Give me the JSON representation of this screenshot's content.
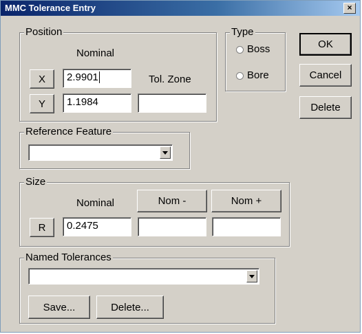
{
  "window": {
    "title": "MMC Tolerance Entry",
    "close_glyph": "×"
  },
  "position": {
    "legend": "Position",
    "nominal_label": "Nominal",
    "tol_zone_label": "Tol. Zone",
    "x_button": "X",
    "y_button": "Y",
    "x_value": "2.9901",
    "y_value": "1.1984",
    "tol_zone_value": ""
  },
  "type": {
    "legend": "Type",
    "boss_label": "Boss",
    "bore_label": "Bore"
  },
  "buttons": {
    "ok": "OK",
    "cancel": "Cancel",
    "delete": "Delete"
  },
  "reference": {
    "legend": "Reference Feature",
    "selected": ""
  },
  "size": {
    "legend": "Size",
    "nominal_label": "Nominal",
    "nom_minus": "Nom -",
    "nom_plus": "Nom +",
    "r_button": "R",
    "r_value": "0.2475",
    "nom_minus_value": "",
    "nom_plus_value": ""
  },
  "named": {
    "legend": "Named Tolerances",
    "selected": "",
    "save": "Save...",
    "delete": "Delete..."
  },
  "icons": {
    "dropdown": "chevron-down-icon",
    "radio": "radio-icon"
  }
}
